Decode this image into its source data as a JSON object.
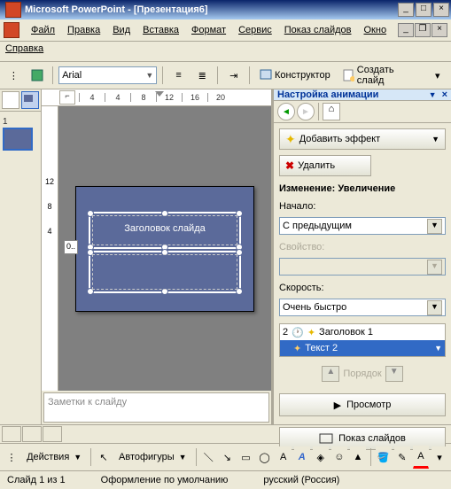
{
  "titlebar": {
    "title": "Microsoft PowerPoint - [Презентация6]"
  },
  "menu": {
    "file": "Файл",
    "edit": "Правка",
    "view": "Вид",
    "insert": "Вставка",
    "format": "Формат",
    "tools": "Сервис",
    "show": "Показ слайдов",
    "window": "Окно",
    "help": "Справка"
  },
  "toolbar": {
    "font": "Arial",
    "designer": "Конструктор",
    "newslide": "Создать слайд"
  },
  "ruler_h": [
    "4",
    "4",
    "8",
    "12",
    "16",
    "20"
  ],
  "ruler_v": [
    "12",
    "8",
    "4"
  ],
  "slide": {
    "num": "1",
    "tag": "0..",
    "title_placeholder": "Заголовок слайда"
  },
  "notes": {
    "placeholder": "Заметки к слайду"
  },
  "anim": {
    "header": "Настройка анимации",
    "add_effect": "Добавить эффект",
    "remove": "Удалить",
    "change_label": "Изменение: Увеличение",
    "start_label": "Начало:",
    "start_value": "С предыдущим",
    "property_label": "Свойство:",
    "speed_label": "Скорость:",
    "speed_value": "Очень быстро",
    "items": [
      {
        "num": "2",
        "label": "Заголовок 1"
      },
      {
        "num": "",
        "label": "Текст 2"
      }
    ],
    "order": "Порядок",
    "preview": "Просмотр",
    "slideshow": "Показ слайдов"
  },
  "drawbar": {
    "actions": "Действия",
    "autoshapes": "Автофигуры"
  },
  "status": {
    "slide": "Слайд 1 из 1",
    "design": "Оформление по умолчанию",
    "lang": "русский (Россия)"
  }
}
